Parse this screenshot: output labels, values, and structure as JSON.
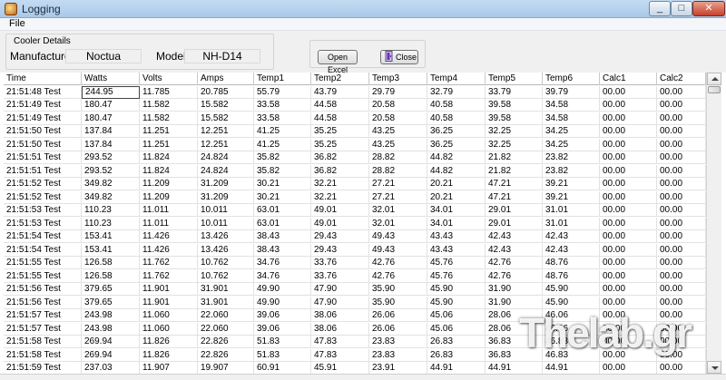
{
  "window": {
    "title": "Logging"
  },
  "menu": {
    "file": "File"
  },
  "cooler": {
    "group_label": "Cooler Details",
    "manufacturer_label": "Manufacturer:",
    "manufacturer_value": "Noctua",
    "model_label": "Model:",
    "model_value": "NH-D14"
  },
  "buttons": {
    "open_excel": "Open Excel",
    "close": "Close"
  },
  "table": {
    "columns": [
      "Time",
      "Watts",
      "Volts",
      "Amps",
      "Temp1",
      "Temp2",
      "Temp3",
      "Temp4",
      "Temp5",
      "Temp6",
      "Calc1",
      "Calc2"
    ],
    "rows": [
      [
        "21:51:48 Test",
        "244.95",
        "11.785",
        "20.785",
        "55.79",
        "43.79",
        "29.79",
        "32.79",
        "33.79",
        "39.79",
        "00.00",
        "00.00"
      ],
      [
        "21:51:49 Test",
        "180.47",
        "11.582",
        "15.582",
        "33.58",
        "44.58",
        "20.58",
        "40.58",
        "39.58",
        "34.58",
        "00.00",
        "00.00"
      ],
      [
        "21:51:49 Test",
        "180.47",
        "11.582",
        "15.582",
        "33.58",
        "44.58",
        "20.58",
        "40.58",
        "39.58",
        "34.58",
        "00.00",
        "00.00"
      ],
      [
        "21:51:50 Test",
        "137.84",
        "11.251",
        "12.251",
        "41.25",
        "35.25",
        "43.25",
        "36.25",
        "32.25",
        "34.25",
        "00.00",
        "00.00"
      ],
      [
        "21:51:50 Test",
        "137.84",
        "11.251",
        "12.251",
        "41.25",
        "35.25",
        "43.25",
        "36.25",
        "32.25",
        "34.25",
        "00.00",
        "00.00"
      ],
      [
        "21:51:51 Test",
        "293.52",
        "11.824",
        "24.824",
        "35.82",
        "36.82",
        "28.82",
        "44.82",
        "21.82",
        "23.82",
        "00.00",
        "00.00"
      ],
      [
        "21:51:51 Test",
        "293.52",
        "11.824",
        "24.824",
        "35.82",
        "36.82",
        "28.82",
        "44.82",
        "21.82",
        "23.82",
        "00.00",
        "00.00"
      ],
      [
        "21:51:52 Test",
        "349.82",
        "11.209",
        "31.209",
        "30.21",
        "32.21",
        "27.21",
        "20.21",
        "47.21",
        "39.21",
        "00.00",
        "00.00"
      ],
      [
        "21:51:52 Test",
        "349.82",
        "11.209",
        "31.209",
        "30.21",
        "32.21",
        "27.21",
        "20.21",
        "47.21",
        "39.21",
        "00.00",
        "00.00"
      ],
      [
        "21:51:53 Test",
        "110.23",
        "11.011",
        "10.011",
        "63.01",
        "49.01",
        "32.01",
        "34.01",
        "29.01",
        "31.01",
        "00.00",
        "00.00"
      ],
      [
        "21:51:53 Test",
        "110.23",
        "11.011",
        "10.011",
        "63.01",
        "49.01",
        "32.01",
        "34.01",
        "29.01",
        "31.01",
        "00.00",
        "00.00"
      ],
      [
        "21:51:54 Test",
        "153.41",
        "11.426",
        "13.426",
        "38.43",
        "29.43",
        "49.43",
        "43.43",
        "42.43",
        "42.43",
        "00.00",
        "00.00"
      ],
      [
        "21:51:54 Test",
        "153.41",
        "11.426",
        "13.426",
        "38.43",
        "29.43",
        "49.43",
        "43.43",
        "42.43",
        "42.43",
        "00.00",
        "00.00"
      ],
      [
        "21:51:55 Test",
        "126.58",
        "11.762",
        "10.762",
        "34.76",
        "33.76",
        "42.76",
        "45.76",
        "42.76",
        "48.76",
        "00.00",
        "00.00"
      ],
      [
        "21:51:55 Test",
        "126.58",
        "11.762",
        "10.762",
        "34.76",
        "33.76",
        "42.76",
        "45.76",
        "42.76",
        "48.76",
        "00.00",
        "00.00"
      ],
      [
        "21:51:56 Test",
        "379.65",
        "11.901",
        "31.901",
        "49.90",
        "47.90",
        "35.90",
        "45.90",
        "31.90",
        "45.90",
        "00.00",
        "00.00"
      ],
      [
        "21:51:56 Test",
        "379.65",
        "11.901",
        "31.901",
        "49.90",
        "47.90",
        "35.90",
        "45.90",
        "31.90",
        "45.90",
        "00.00",
        "00.00"
      ],
      [
        "21:51:57 Test",
        "243.98",
        "11.060",
        "22.060",
        "39.06",
        "38.06",
        "26.06",
        "45.06",
        "28.06",
        "46.06",
        "00.00",
        "00.00"
      ],
      [
        "21:51:57 Test",
        "243.98",
        "11.060",
        "22.060",
        "39.06",
        "38.06",
        "26.06",
        "45.06",
        "28.06",
        "46.06",
        "00.00",
        "00.00"
      ],
      [
        "21:51:58 Test",
        "269.94",
        "11.826",
        "22.826",
        "51.83",
        "47.83",
        "23.83",
        "26.83",
        "36.83",
        "46.83",
        "00.00",
        "00.00"
      ],
      [
        "21:51:58 Test",
        "269.94",
        "11.826",
        "22.826",
        "51.83",
        "47.83",
        "23.83",
        "26.83",
        "36.83",
        "46.83",
        "00.00",
        "00.00"
      ],
      [
        "21:51:59 Test",
        "237.03",
        "11.907",
        "19.907",
        "60.91",
        "45.91",
        "23.91",
        "44.91",
        "44.91",
        "44.91",
        "00.00",
        "00.00"
      ]
    ]
  },
  "watermark": "Thelab.gr"
}
